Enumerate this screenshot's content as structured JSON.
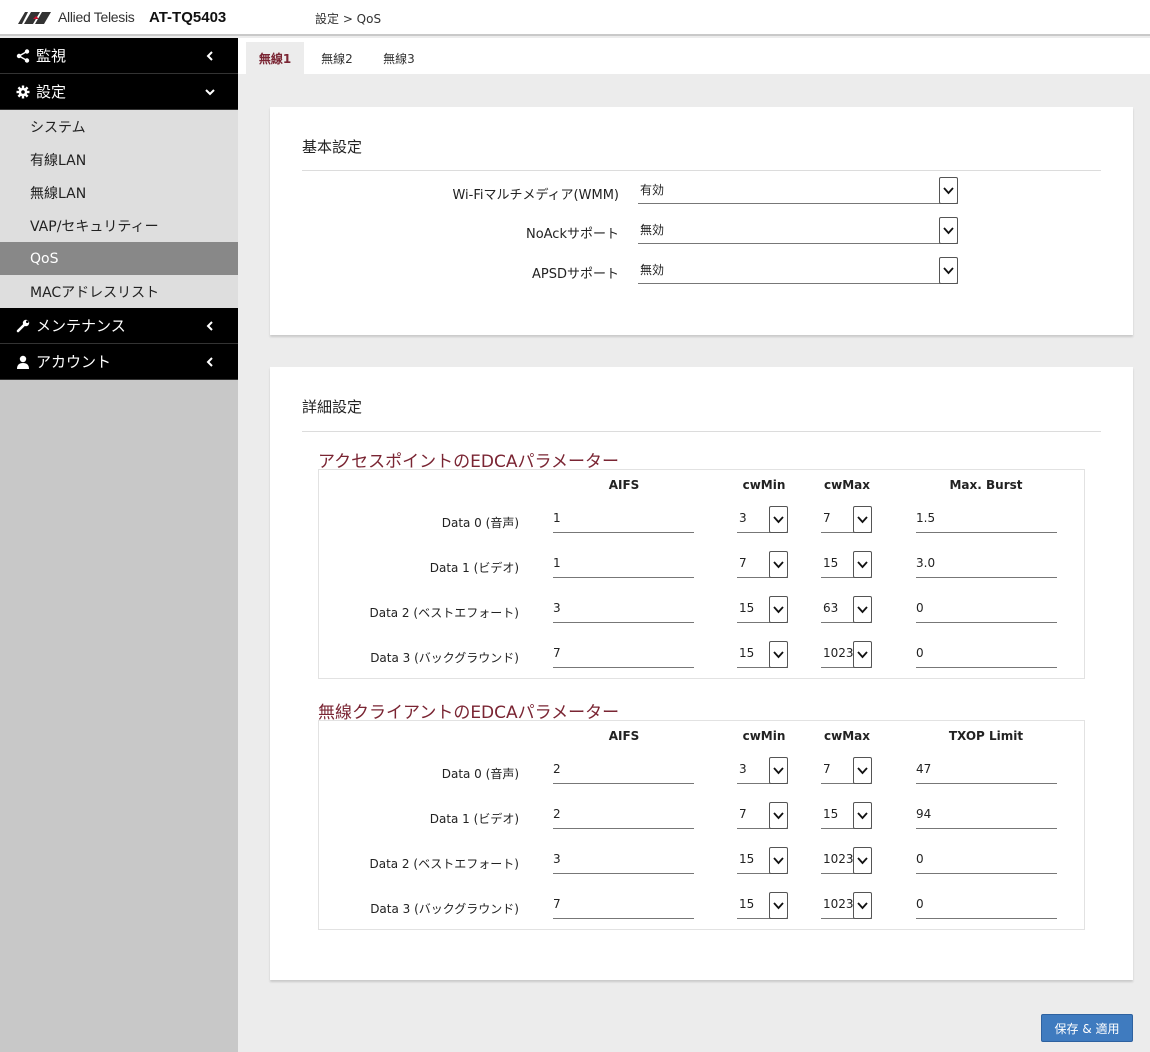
{
  "header": {
    "brand": "Allied Telesis",
    "model": "AT-TQ5403",
    "breadcrumb": "設定 > QoS"
  },
  "sidebar": {
    "groups": [
      {
        "label": "監視",
        "icon": "share-icon",
        "expanded": false
      },
      {
        "label": "設定",
        "icon": "gear-icon",
        "expanded": true,
        "items": [
          "システム",
          "有線LAN",
          "無線LAN",
          "VAP/セキュリティー",
          "QoS",
          "MACアドレスリスト"
        ]
      },
      {
        "label": "メンテナンス",
        "icon": "wrench-icon",
        "expanded": false
      },
      {
        "label": "アカウント",
        "icon": "user-icon",
        "expanded": false
      }
    ],
    "active_item": "QoS"
  },
  "tabs": [
    "無線1",
    "無線2",
    "無線3"
  ],
  "active_tab": "無線1",
  "basic": {
    "title": "基本設定",
    "rows": [
      {
        "label": "Wi-Fiマルチメディア(WMM)",
        "value": "有効"
      },
      {
        "label": "NoAckサポート",
        "value": "無効"
      },
      {
        "label": "APSDサポート",
        "value": "無効"
      }
    ]
  },
  "advanced": {
    "title": "詳細設定",
    "ap": {
      "title": "アクセスポイントのEDCAパラメーター",
      "headers": [
        "AIFS",
        "cwMin",
        "cwMax",
        "Max. Burst"
      ],
      "rows": [
        {
          "label": "Data 0 (音声)",
          "aifs": "1",
          "cwmin": "3",
          "cwmax": "7",
          "last": "1.5"
        },
        {
          "label": "Data 1 (ビデオ)",
          "aifs": "1",
          "cwmin": "7",
          "cwmax": "15",
          "last": "3.0"
        },
        {
          "label": "Data 2 (ベストエフォート)",
          "aifs": "3",
          "cwmin": "15",
          "cwmax": "63",
          "last": "0"
        },
        {
          "label": "Data 3 (バックグラウンド)",
          "aifs": "7",
          "cwmin": "15",
          "cwmax": "1023",
          "last": "0"
        }
      ]
    },
    "client": {
      "title": "無線クライアントのEDCAパラメーター",
      "headers": [
        "AIFS",
        "cwMin",
        "cwMax",
        "TXOP Limit"
      ],
      "rows": [
        {
          "label": "Data 0 (音声)",
          "aifs": "2",
          "cwmin": "3",
          "cwmax": "7",
          "last": "47"
        },
        {
          "label": "Data 1 (ビデオ)",
          "aifs": "2",
          "cwmin": "7",
          "cwmax": "15",
          "last": "94"
        },
        {
          "label": "Data 2 (ベストエフォート)",
          "aifs": "3",
          "cwmin": "15",
          "cwmax": "1023",
          "last": "0"
        },
        {
          "label": "Data 3 (バックグラウンド)",
          "aifs": "7",
          "cwmin": "15",
          "cwmax": "1023",
          "last": "0"
        }
      ]
    }
  },
  "save_label": "保存 & 適用",
  "colors": {
    "accent": "#7a2533",
    "button": "#3f7bbf",
    "sidebar_bg": "#c8c8c8"
  }
}
